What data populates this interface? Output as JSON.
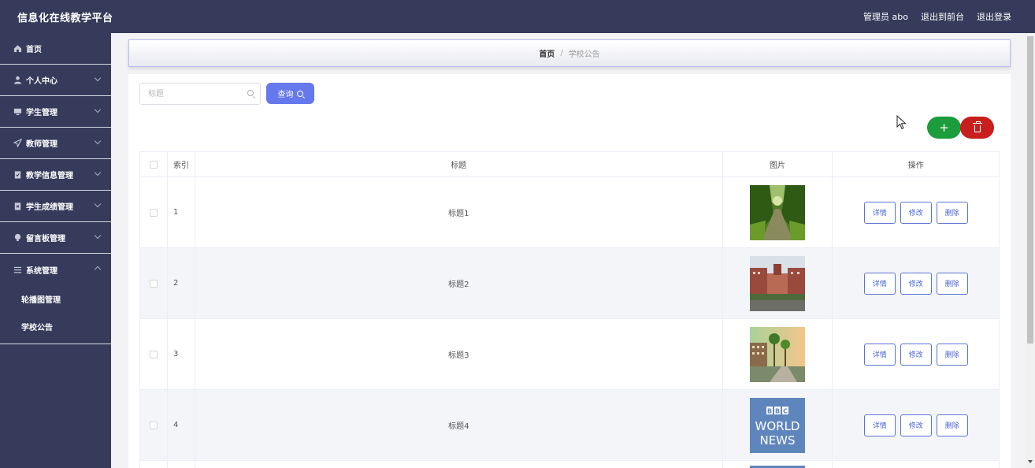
{
  "app": {
    "title": "信息化在线教学平台"
  },
  "header": {
    "admin_label": "管理员 abo",
    "back_front": "退出到前台",
    "logout": "退出登录"
  },
  "sidebar": {
    "items": [
      {
        "label": "首页",
        "icon": "home-icon"
      },
      {
        "label": "个人中心",
        "icon": "user-icon"
      },
      {
        "label": "学生管理",
        "icon": "monitor-icon"
      },
      {
        "label": "教师管理",
        "icon": "send-icon"
      },
      {
        "label": "教学信息管理",
        "icon": "clipboard-icon"
      },
      {
        "label": "学生成绩管理",
        "icon": "clipboard-icon"
      },
      {
        "label": "留言板管理",
        "icon": "lightbulb-icon"
      },
      {
        "label": "系统管理",
        "icon": "menu-icon"
      }
    ],
    "sub_items": [
      {
        "label": "轮播图管理"
      },
      {
        "label": "学校公告"
      }
    ]
  },
  "breadcrumb": {
    "home": "首页",
    "separator": "/",
    "current": "学校公告"
  },
  "search": {
    "placeholder": "标题",
    "button_label": "查询"
  },
  "actions": {
    "add": "+"
  },
  "table": {
    "columns": [
      "索引",
      "标题",
      "图片",
      "操作"
    ],
    "rows": [
      {
        "index": "1",
        "title": "标题1"
      },
      {
        "index": "2",
        "title": "标题2"
      },
      {
        "index": "3",
        "title": "标题3"
      },
      {
        "index": "4",
        "title": "标题4"
      }
    ],
    "op_labels": {
      "detail": "详情",
      "edit": "修改",
      "delete": "删除"
    }
  },
  "images": {
    "bbc_line1": "BBC",
    "bbc_line2": "WORLD",
    "bbc_line3": "NEWS"
  },
  "colors": {
    "sidebar_bg": "#363b5b",
    "primary": "#6678ee",
    "add_green": "#1c9c3b",
    "delete_red": "#c81e1e",
    "op_blue": "#4a64d6"
  }
}
